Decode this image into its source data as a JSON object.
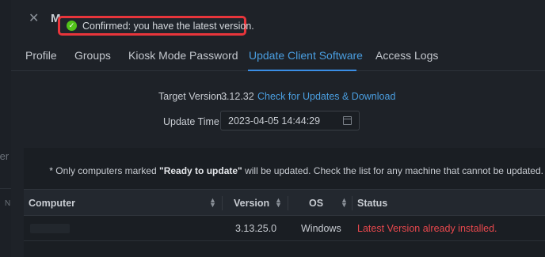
{
  "backdrop": {
    "left_text": "ter",
    "row_text": "N"
  },
  "dialog": {
    "title": "M"
  },
  "toast": {
    "message": "Confirmed: you have the latest version."
  },
  "tabs": [
    {
      "label": "Profile",
      "active": false
    },
    {
      "label": "Groups",
      "active": false
    },
    {
      "label": "Kiosk Mode Password",
      "active": false
    },
    {
      "label": "Update Client Software",
      "active": true
    },
    {
      "label": "Access Logs",
      "active": false
    }
  ],
  "form": {
    "target_version_label": "Target Version :",
    "target_version_value": "3.12.32",
    "check_link": "Check for Updates & Download",
    "update_time_label": "Update Time :",
    "update_time_value": "2023-04-05 14:44:29"
  },
  "note": {
    "prefix": "* Only computers marked ",
    "highlight": "\"Ready to update\"",
    "suffix": " will be updated. Check the list for any machine that cannot be updated."
  },
  "table": {
    "columns": [
      "Computer",
      "Version",
      "OS",
      "Status"
    ],
    "rows": [
      {
        "computer": "",
        "version": "3.13.25.0",
        "os": "Windows",
        "status": "Latest Version already installed."
      }
    ]
  },
  "colors": {
    "accent": "#4a9ee0",
    "error": "#e8484d",
    "success": "#52c41a",
    "highlight_border": "#e8353b"
  }
}
